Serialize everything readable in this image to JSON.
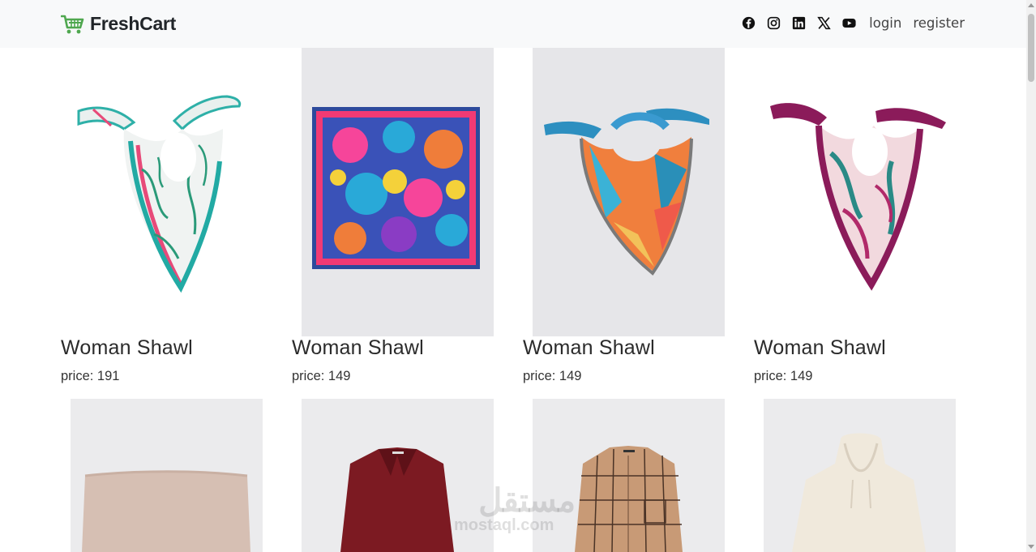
{
  "navbar": {
    "brand": "FreshCart",
    "brand_color": "#4fa74f",
    "social_icons": [
      "facebook-icon",
      "instagram-icon",
      "linkedin-icon",
      "x-icon",
      "youtube-icon"
    ],
    "login_label": "login",
    "register_label": "register"
  },
  "products": [
    {
      "title": "Woman Shawl",
      "price_label": "price: 191",
      "image": "white-teal-pink-floral-shawl"
    },
    {
      "title": "Woman Shawl",
      "price_label": "price: 149",
      "image": "blue-pink-floral-square-scarf"
    },
    {
      "title": "Woman Shawl",
      "price_label": "price: 149",
      "image": "orange-teal-geometric-shawl"
    },
    {
      "title": "Woman Shawl",
      "price_label": "price: 149",
      "image": "purple-pink-leaf-shawl"
    },
    {
      "image": "beige-folded-fabric"
    },
    {
      "image": "burgundy-blouse"
    },
    {
      "image": "beige-plaid-shirt"
    },
    {
      "image": "cream-hoodie"
    }
  ],
  "watermark": {
    "arabic": "مستقل",
    "latin": "mostaql.com"
  }
}
